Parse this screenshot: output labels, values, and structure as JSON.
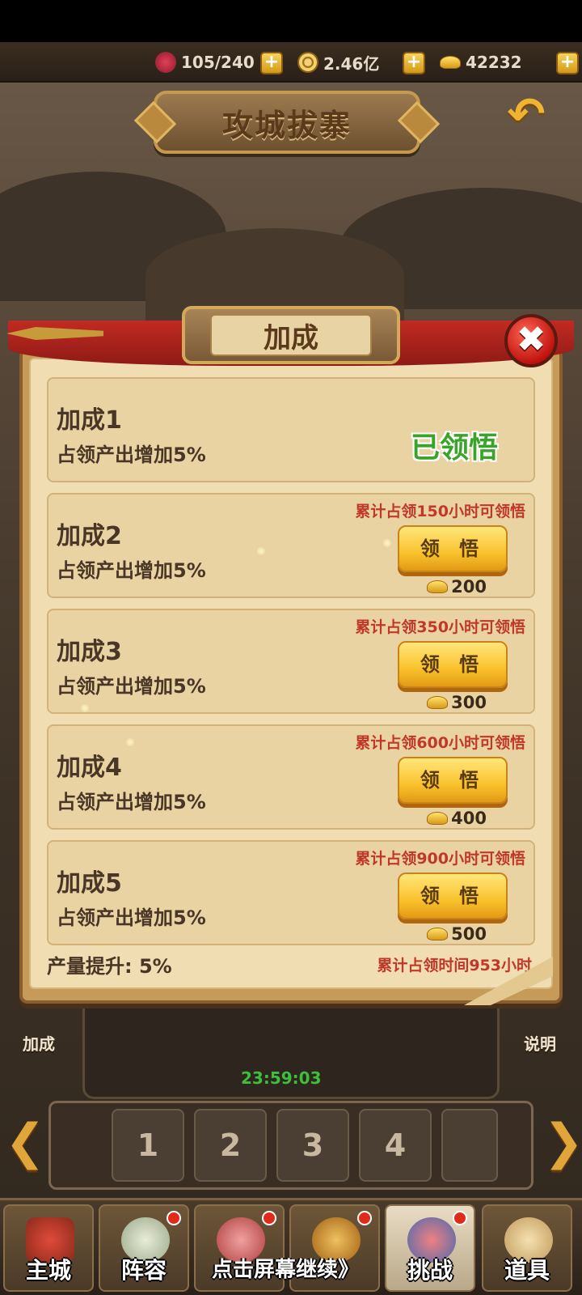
{
  "resources": {
    "stamina": "105/240",
    "coins": "2.46亿",
    "ingots": "42232",
    "add_label": "+"
  },
  "page_title": "攻城拔寨",
  "back_glyph": "↶",
  "dialog": {
    "title": "加成",
    "close_glyph": "✖",
    "cards": [
      {
        "name": "加成1",
        "desc": "占领产出增加5%",
        "status": "已领悟"
      },
      {
        "name": "加成2",
        "desc": "占领产出增加5%",
        "condition": "累计占领150小时可领悟",
        "button": "领 悟",
        "cost": "200"
      },
      {
        "name": "加成3",
        "desc": "占领产出增加5%",
        "condition": "累计占领350小时可领悟",
        "button": "领 悟",
        "cost": "300"
      },
      {
        "name": "加成4",
        "desc": "占领产出增加5%",
        "condition": "累计占领600小时可领悟",
        "button": "领 悟",
        "cost": "400"
      },
      {
        "name": "加成5",
        "desc": "占领产出增加5%",
        "condition": "累计占领900小时可领悟",
        "button": "领 悟",
        "cost": "500"
      }
    ],
    "footer_left": "产量提升: 5%",
    "footer_right": "累计占领时间953小时"
  },
  "background": {
    "left_button": "加成",
    "right_button": "说明",
    "timer": "23:59:03",
    "levels": [
      "1",
      "2",
      "3",
      "4"
    ],
    "prev_glyph": "❮",
    "next_glyph": "❯"
  },
  "nav": {
    "items": [
      "主城",
      "阵容",
      "",
      "",
      "挑战",
      "道具"
    ],
    "continue_tip": "点击屏幕继续》"
  },
  "colors": {
    "condition_red": "#c0382a",
    "learned_green": "#3aa42a",
    "timer_green": "#3cc03c"
  }
}
